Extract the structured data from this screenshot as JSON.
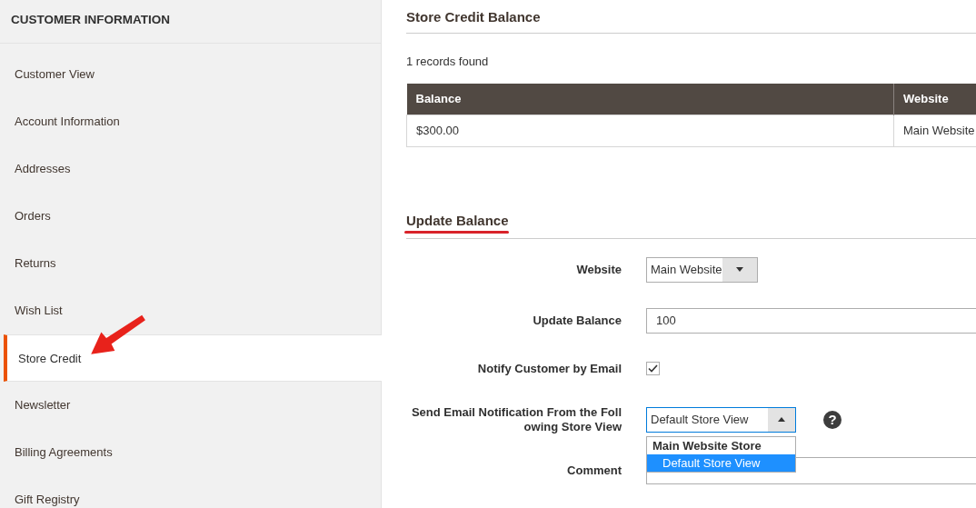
{
  "sidebar": {
    "title": "CUSTOMER INFORMATION",
    "items": [
      {
        "label": "Customer View",
        "selected": false
      },
      {
        "label": "Account Information",
        "selected": false
      },
      {
        "label": "Addresses",
        "selected": false
      },
      {
        "label": "Orders",
        "selected": false
      },
      {
        "label": "Returns",
        "selected": false
      },
      {
        "label": "Wish List",
        "selected": false
      },
      {
        "label": "Store Credit",
        "selected": true
      },
      {
        "label": "Newsletter",
        "selected": false
      },
      {
        "label": "Billing Agreements",
        "selected": false
      },
      {
        "label": "Gift Registry",
        "selected": false
      }
    ]
  },
  "balance": {
    "title": "Store Credit Balance",
    "records": "1 records found",
    "table": {
      "columns": [
        "Balance",
        "Website"
      ],
      "rows": [
        [
          "$300.00",
          "Main Website"
        ]
      ]
    }
  },
  "update": {
    "title": "Update Balance",
    "fields": [
      {
        "kind": "select",
        "label": "Website",
        "value": "Main Website",
        "expanded": false
      },
      {
        "kind": "text",
        "label": "Update Balance",
        "value": "100"
      },
      {
        "kind": "checkbox",
        "label": "Notify Customer by Email",
        "checked": true
      },
      {
        "kind": "select",
        "label": "Send Email Notification From the Following Store View",
        "value": "Default Store View",
        "expanded": true,
        "help": "?",
        "options": [
          {
            "kind": "group",
            "label": "Main Website Store",
            "selected": false
          },
          {
            "kind": "option",
            "label": "Default Store View",
            "selected": true
          }
        ]
      },
      {
        "kind": "textarea",
        "label": "Comment"
      }
    ]
  }
}
